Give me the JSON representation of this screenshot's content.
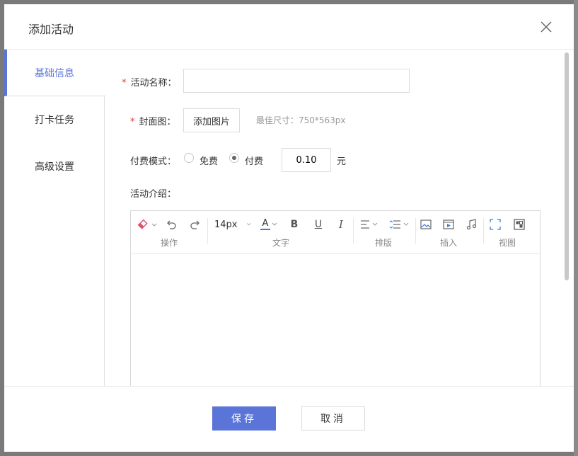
{
  "dialog": {
    "title": "添加活动"
  },
  "sidebar": {
    "items": [
      {
        "label": "基础信息"
      },
      {
        "label": "打卡任务"
      },
      {
        "label": "高级设置"
      }
    ]
  },
  "form": {
    "name_label": "活动名称：",
    "name_value": "",
    "cover_label": "封面图：",
    "cover_button": "添加图片",
    "cover_hint": "最佳尺寸：750*563px",
    "pay_label": "付费模式：",
    "pay_free": "免费",
    "pay_paid": "付费",
    "selected_mode": "付费",
    "price_value": "0.10",
    "price_unit": "元",
    "intro_label": "活动介绍：",
    "required_mark": "*"
  },
  "editor": {
    "font_size": "14px",
    "groups": [
      "操作",
      "文字",
      "排版",
      "插入",
      "视图"
    ],
    "icons": [
      "eraser-icon",
      "undo-icon",
      "redo-icon",
      "font-color-icon",
      "bold-icon",
      "underline-icon",
      "italic-icon",
      "align-icon",
      "line-height-icon",
      "image-icon",
      "video-icon",
      "music-icon",
      "fullscreen-icon",
      "source-code-icon"
    ],
    "bold_label": "B",
    "underline_label": "U",
    "italic_label": "I",
    "font_color_label": "A"
  },
  "footer": {
    "save_label": "保存",
    "cancel_label": "取消"
  },
  "colors": {
    "primary": "#5a74d8",
    "required": "#e03b3b",
    "eraser": "#e0506a",
    "font_color_bar": "#3a7bd5"
  }
}
